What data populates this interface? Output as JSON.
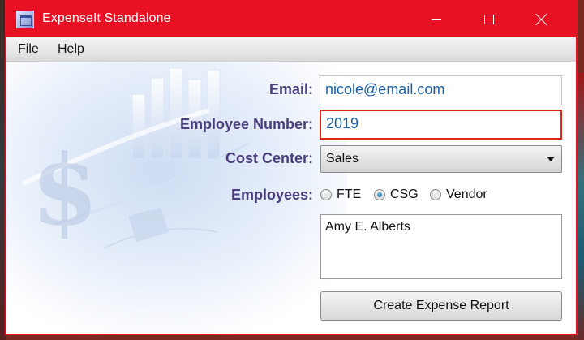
{
  "window": {
    "title": "ExpenseIt Standalone",
    "accent_color": "#e81123"
  },
  "menu": {
    "items": [
      "File",
      "Help"
    ]
  },
  "form": {
    "email_label": "Email:",
    "email_value": "nicole@email.com",
    "employee_number_label": "Employee Number:",
    "employee_number_value": "2019",
    "cost_center_label": "Cost Center:",
    "cost_center_value": "Sales",
    "employees_label": "Employees:",
    "employee_types": [
      {
        "label": "FTE",
        "checked": false
      },
      {
        "label": "CSG",
        "checked": true
      },
      {
        "label": "Vendor",
        "checked": false
      }
    ],
    "employee_list": [
      "Amy E. Alberts"
    ],
    "create_button": "Create Expense Report"
  },
  "colors": {
    "label_color": "#4b3e7c",
    "value_color": "#1a5fa8",
    "error_border": "#e2231a"
  }
}
